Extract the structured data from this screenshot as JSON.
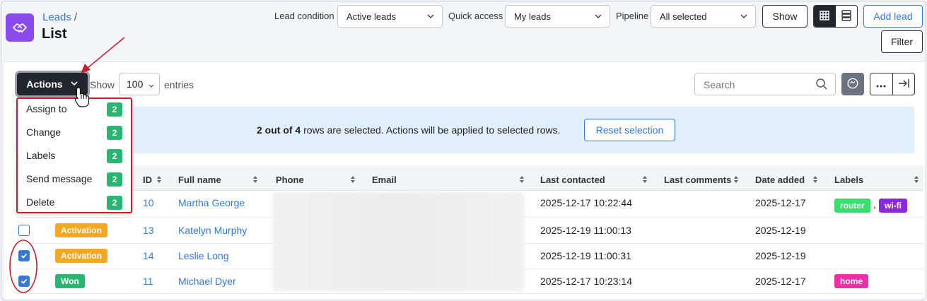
{
  "header": {
    "breadcrumb_parent": "Leads",
    "breadcrumb_sep": "/",
    "title": "List",
    "filters": {
      "lead_condition_label": "Lead condition",
      "lead_condition_value": "Active leads",
      "quick_access_label": "Quick access",
      "quick_access_value": "My leads",
      "pipeline_label": "Pipeline",
      "pipeline_value": "All selected"
    },
    "show_button": "Show",
    "add_lead_button": "Add lead",
    "filter_button": "Filter"
  },
  "toolbar": {
    "actions_label": "Actions",
    "show_label": "Show",
    "entries_value": "100",
    "entries_label": "entries",
    "search_placeholder": "Search"
  },
  "actions_menu": [
    {
      "label": "Assign to",
      "count": "2"
    },
    {
      "label": "Change",
      "count": "2"
    },
    {
      "label": "Labels",
      "count": "2"
    },
    {
      "label": "Send message",
      "count": "2"
    },
    {
      "label": "Delete",
      "count": "2"
    }
  ],
  "selection_notice": {
    "bold": "2 out of 4",
    "rest": " rows are selected. Actions will be applied to selected rows.",
    "reset_button": "Reset selection"
  },
  "table": {
    "columns": [
      "ID",
      "Full name",
      "Phone",
      "Email",
      "Last contacted",
      "Last comments",
      "Date added",
      "Labels"
    ],
    "rows": [
      {
        "checked": false,
        "status": "",
        "id": "10",
        "name": "Martha George",
        "last_contacted": "2025-12-17 10:22:44",
        "date_added": "2025-12-17",
        "labels": [
          "router",
          "wi-fi"
        ],
        "label_sep": ","
      },
      {
        "checked": false,
        "status": "Activation",
        "id": "13",
        "name": "Katelyn Murphy",
        "last_contacted": "2025-12-19 11:00:13",
        "date_added": "2025-12-19",
        "labels": []
      },
      {
        "checked": true,
        "status": "Activation",
        "id": "14",
        "name": "Leslie Long",
        "last_contacted": "2025-12-19 11:00:31",
        "date_added": "2025-12-19",
        "labels": []
      },
      {
        "checked": true,
        "status": "Won",
        "id": "11",
        "name": "Michael Dyer",
        "last_contacted": "2025-12-17 10:23:14",
        "date_added": "2025-12-17",
        "labels": [
          "home"
        ]
      }
    ]
  },
  "colors": {
    "accent": "#3578d6",
    "app_icon": "#8a4bf0",
    "badge_activation": "#f5a623",
    "badge_won": "#2bb573",
    "label_router": "#3ddc6e",
    "label_wifi": "#8b28e0",
    "label_home": "#ee2fa8",
    "annotation_red": "#c8202a"
  },
  "icons": [
    "handshake-icon",
    "chevron-down-icon",
    "grid-icon",
    "list-icon",
    "search-icon",
    "ellipsis-icon",
    "export-icon",
    "sort-icon",
    "check-icon",
    "cursor-hand-icon"
  ]
}
